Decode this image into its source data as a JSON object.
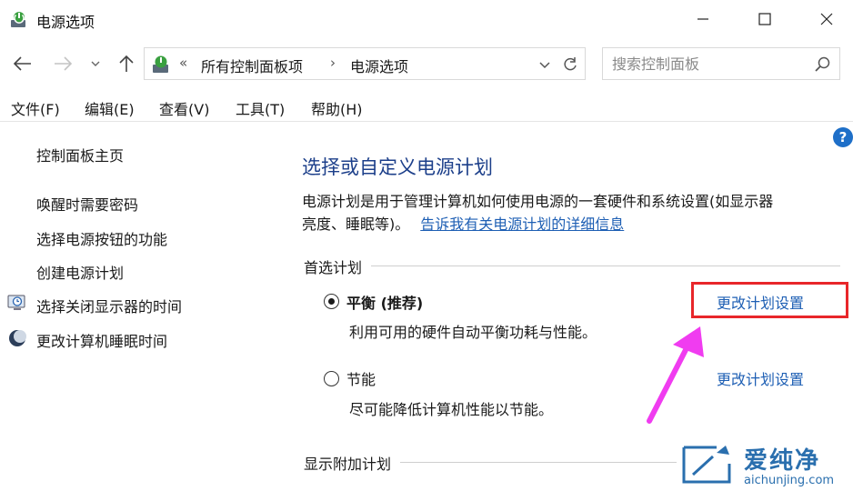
{
  "window": {
    "title": "电源选项",
    "minimize_icon": "minimize-icon",
    "maximize_icon": "maximize-icon",
    "close_icon": "close-icon"
  },
  "address_bar": {
    "breadcrumb_overflow": "«",
    "crumbs": [
      "所有控制面板项",
      "电源选项"
    ],
    "separator": "›"
  },
  "search": {
    "placeholder": "搜索控制面板"
  },
  "menu": {
    "items": [
      "文件(F)",
      "编辑(E)",
      "查看(V)",
      "工具(T)",
      "帮助(H)"
    ]
  },
  "help": {
    "label": "?"
  },
  "left_nav": {
    "home": "控制面板主页",
    "links": [
      "唤醒时需要密码",
      "选择电源按钮的功能",
      "创建电源计划",
      "选择关闭显示器的时间",
      "更改计算机睡眠时间"
    ]
  },
  "main": {
    "title": "选择或自定义电源计划",
    "description_line1": "电源计划是用于管理计算机如何使用电源的一套硬件和系统设置(如显示器",
    "description_line2": "亮度、睡眠等)。",
    "description_link": "告诉我有关电源计划的详细信息",
    "preferred_section": "首选计划",
    "plans": [
      {
        "name": "平衡 (推荐)",
        "description": "利用可用的硬件自动平衡功耗与性能。",
        "link": "更改计划设置",
        "selected": true
      },
      {
        "name": "节能",
        "description": "尽可能降低计算机性能以节能。",
        "link": "更改计划设置",
        "selected": false
      }
    ],
    "additional_section": "显示附加计划"
  },
  "watermark": {
    "brand": "爱纯净",
    "url": "aichunjing.com"
  },
  "colors": {
    "title_blue": "#1c3f8a",
    "link_blue": "#1e5fb4",
    "highlight_red": "#e8262a",
    "arrow_magenta": "#f03cf0",
    "watermark_blue": "#2a6fae"
  }
}
